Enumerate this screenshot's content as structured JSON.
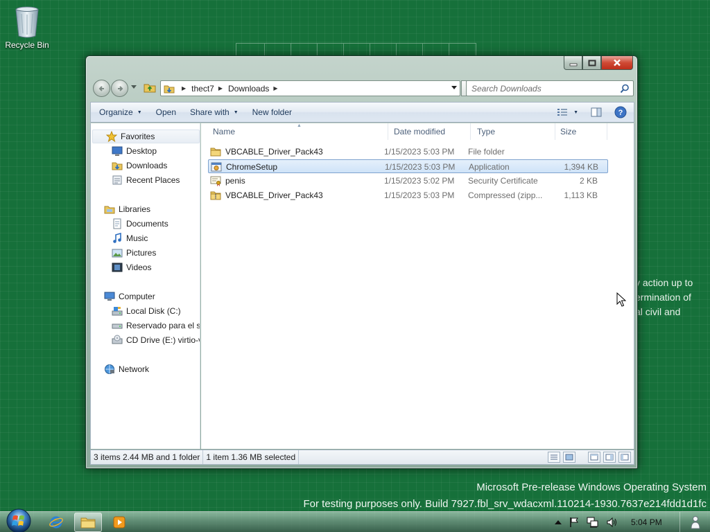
{
  "desktop": {
    "recycle_bin_label": "Recycle Bin",
    "background_text": [
      "y action up to",
      "ermination of",
      "al civil and"
    ],
    "watermark_line1": "Microsoft Pre-release Windows Operating System",
    "watermark_line2": "For testing purposes only. Build 7927.fbl_srv_wdacxml.110214-1930.7637e214fdd1d1fc"
  },
  "window": {
    "address": {
      "crumbs": [
        "thect7",
        "Downloads"
      ]
    },
    "search": {
      "placeholder": "Search Downloads"
    },
    "toolbar": {
      "organize": "Organize",
      "open": "Open",
      "share_with": "Share with",
      "new_folder": "New folder"
    },
    "nav": {
      "favorites": "Favorites",
      "desktop": "Desktop",
      "downloads": "Downloads",
      "recent_places": "Recent Places",
      "libraries": "Libraries",
      "documents": "Documents",
      "music": "Music",
      "pictures": "Pictures",
      "videos": "Videos",
      "computer": "Computer",
      "local_disk": "Local Disk (C:)",
      "reserved": "Reservado para el sis",
      "cd_drive": "CD Drive (E:) virtio-v",
      "network": "Network"
    },
    "columns": {
      "name": "Name",
      "date": "Date modified",
      "type": "Type",
      "size": "Size"
    },
    "files": [
      {
        "name": "VBCABLE_Driver_Pack43",
        "date": "1/15/2023 5:03 PM",
        "type": "File folder",
        "size": "",
        "icon": "folder-icon"
      },
      {
        "name": "ChromeSetup",
        "date": "1/15/2023 5:03 PM",
        "type": "Application",
        "size": "1,394 KB",
        "icon": "application-icon",
        "selected": true
      },
      {
        "name": "penis",
        "date": "1/15/2023 5:02 PM",
        "type": "Security Certificate",
        "size": "2 KB",
        "icon": "certificate-icon"
      },
      {
        "name": "VBCABLE_Driver_Pack43",
        "date": "1/15/2023 5:03 PM",
        "type": "Compressed (zipp...",
        "size": "1,113 KB",
        "icon": "zip-folder-icon"
      }
    ],
    "status": {
      "items_summary": "3 items 2.44 MB and 1 folder",
      "selection": "1 item 1.36 MB selected"
    }
  },
  "taskbar": {
    "clock": "5:04 PM"
  },
  "colors": {
    "desktop_bg": "#16703a",
    "selection_border": "#7da2ce",
    "close_button": "#cf4a35"
  }
}
